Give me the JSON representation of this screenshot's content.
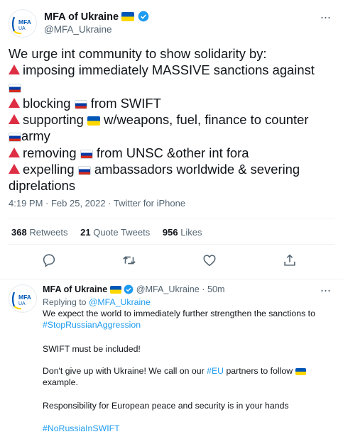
{
  "tweet": {
    "author_name": "MFA of Ukraine",
    "author_handle": "@MFA_Ukraine",
    "avatar_text_top": "MFA",
    "avatar_text_bottom": "UA",
    "text_intro": "We urge int community to show solidarity by:",
    "item1_a": "imposing immediately MASSIVE sanctions against",
    "item2_a": "blocking",
    "item2_b": "from SWIFT",
    "item3_a": "supporting",
    "item3_b": "w/weapons, fuel, finance to counter",
    "item3_c": "army",
    "item4_a": "removing",
    "item4_b": "from UNSC &other int fora",
    "item5_a": "expelling",
    "item5_b": "ambassadors worldwide & severing",
    "item5_c": "diprelations",
    "timestamp": "4:19 PM · Feb 25, 2022 · Twitter for iPhone",
    "retweets_count": "368",
    "retweets_label": "Retweets",
    "quotes_count": "21",
    "quotes_label": "Quote Tweets",
    "likes_count": "956",
    "likes_label": "Likes",
    "more_label": "···"
  },
  "reply": {
    "author_name": "MFA of Ukraine",
    "author_handle": "@MFA_Ukraine",
    "time": "· 50m",
    "replying_prefix": "Replying to",
    "replying_to": "@MFA_Ukraine",
    "p1": "We expect the world to immediately further strengthen the sanctions to",
    "p1_tag": "#StopRussianAggression",
    "p2": "SWIFT must be included!",
    "p3_a": "Don't give up with Ukraine! We call on our",
    "p3_tag": "#EU",
    "p3_b": "partners to follow",
    "p3_c": "example.",
    "p4": "Responsibility for European peace and security is in your hands",
    "p5_tag": "#NoRussiaInSWIFT",
    "more_label": "···"
  },
  "colors": {
    "accent": "#1d9bf0",
    "secondary_text": "#536471",
    "triangle": "#dd2e44"
  },
  "icons": [
    "verified-badge-icon",
    "reply-icon",
    "retweet-icon",
    "like-icon",
    "share-icon",
    "more-icon",
    "ukraine-flag-icon",
    "russia-flag-icon",
    "red-triangle-icon"
  ]
}
